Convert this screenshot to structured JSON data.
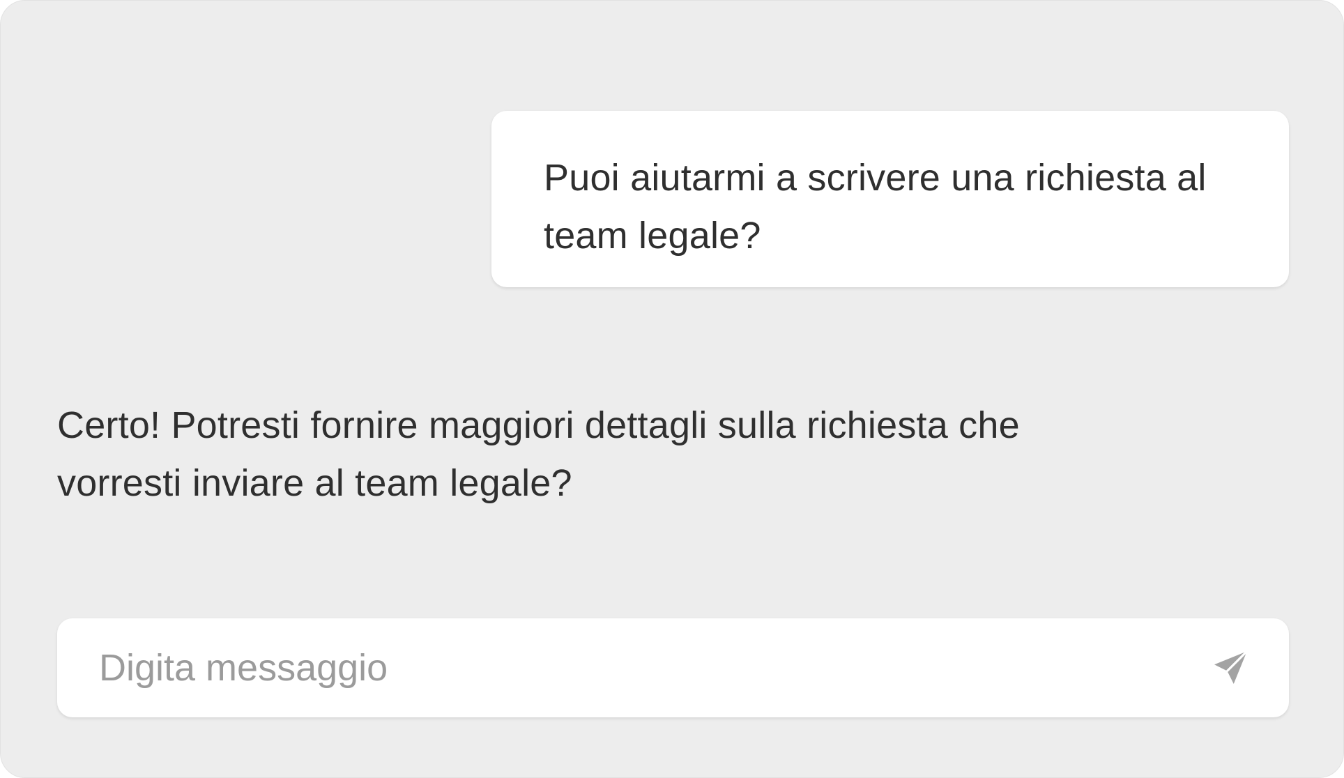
{
  "conversation": {
    "messages": [
      {
        "role": "user",
        "text": "Puoi aiutarmi a scrivere una richiesta al team legale?"
      },
      {
        "role": "assistant",
        "text": "Certo! Potresti fornire maggiori dettagli sulla richiesta che vorresti inviare al team legale?"
      }
    ]
  },
  "composer": {
    "placeholder": "Digita messaggio",
    "value": "",
    "send_icon": "send-paper-plane-icon"
  },
  "colors": {
    "panel_background": "#ededed",
    "bubble_background": "#ffffff",
    "text": "#2f2f2f",
    "placeholder": "#9b9b9b",
    "icon": "#a3a3a3"
  }
}
